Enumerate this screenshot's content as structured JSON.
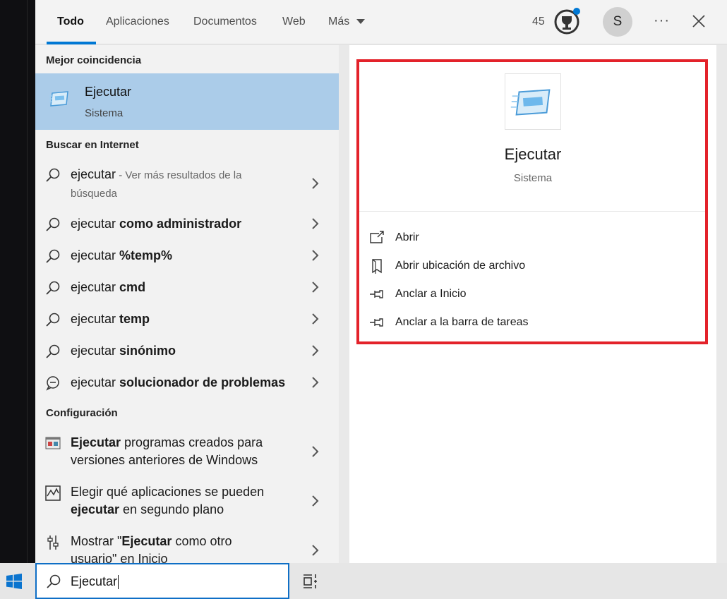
{
  "tabs": [
    {
      "label": "Todo",
      "active": true
    },
    {
      "label": "Aplicaciones",
      "active": false
    },
    {
      "label": "Documentos",
      "active": false
    },
    {
      "label": "Web",
      "active": false
    },
    {
      "label": "Más",
      "active": false
    }
  ],
  "header": {
    "points": "45",
    "avatar_initial": "S",
    "more_label": "···",
    "icons": [
      "trophy-icon",
      "close-icon",
      "chevron-down-icon"
    ]
  },
  "results": {
    "best_match_title": "Mejor coincidencia",
    "best_match": {
      "name": "Ejecutar",
      "type": "Sistema",
      "icon": "run-app-icon"
    },
    "web_title": "Buscar en Internet",
    "web_items": [
      {
        "query": "ejecutar",
        "rest": "",
        "muted": " - Ver más resultados de la",
        "muted2": "búsqueda",
        "icon": "search-icon"
      },
      {
        "query": "ejecutar ",
        "rest": "como administrador",
        "icon": "search-icon"
      },
      {
        "query": "ejecutar ",
        "rest": "%temp%",
        "icon": "search-icon"
      },
      {
        "query": "ejecutar ",
        "rest": "cmd",
        "icon": "search-icon"
      },
      {
        "query": "ejecutar ",
        "rest": "temp",
        "icon": "search-icon"
      },
      {
        "query": "ejecutar ",
        "rest": "sinónimo",
        "icon": "search-icon"
      },
      {
        "query": "ejecutar ",
        "rest": "solucionador de problemas",
        "icon": "chat-icon"
      }
    ],
    "config_title": "Configuración",
    "config_items": [
      {
        "line1_bold": "Ejecutar",
        "line1": " programas creados para",
        "line2": "versiones anteriores de Windows",
        "icon": "compatibility-icon"
      },
      {
        "line1": "Elegir qué aplicaciones se pueden",
        "line2_bold": "ejecutar",
        "line2": " en segundo plano",
        "icon": "activity-icon"
      },
      {
        "line1_pre": "Mostrar \"",
        "line1_bold": "Ejecutar",
        "line1_post": " como otro",
        "line2": "usuario\" en Inicio",
        "icon": "settings-sliders-icon"
      }
    ]
  },
  "detail": {
    "app_name": "Ejecutar",
    "app_type": "Sistema",
    "actions": [
      {
        "label": "Abrir",
        "icon": "open-icon"
      },
      {
        "label": "Abrir ubicación de archivo",
        "icon": "file-location-icon"
      },
      {
        "label": "Anclar a Inicio",
        "icon": "pin-icon"
      },
      {
        "label": "Anclar a la barra de tareas",
        "icon": "pin-icon"
      }
    ],
    "highlight_color": "#e3222a"
  },
  "taskbar": {
    "search_value": "Ejecutar",
    "icons": [
      "windows-start-icon",
      "search-icon",
      "task-view-icon"
    ]
  },
  "colors": {
    "accent": "#0078d4",
    "selected": "#abcce9"
  }
}
